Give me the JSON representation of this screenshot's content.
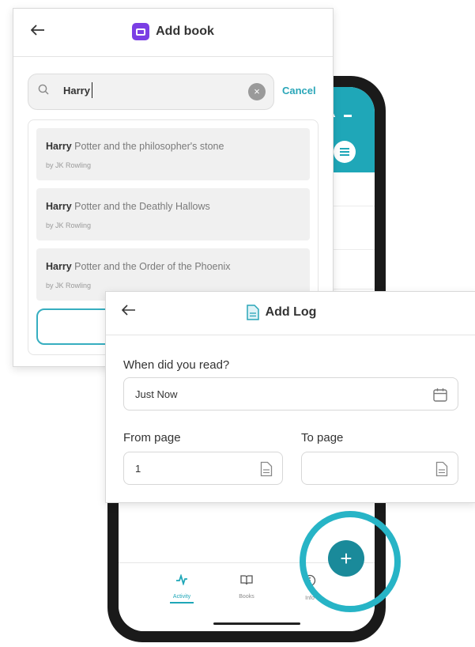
{
  "add_book": {
    "title": "Add book",
    "search": {
      "value": "Harry"
    },
    "cancel_label": "Cancel",
    "results": [
      {
        "match": "Harry",
        "rest": " Potter and the philosopher's stone",
        "author": "by JK Rowling"
      },
      {
        "match": "Harry",
        "rest": " Potter and the Deathly Hallows",
        "author": "by JK Rowling"
      },
      {
        "match": "Harry",
        "rest": " Potter and the Order of the Phoenix",
        "author": "by JK Rowling"
      }
    ]
  },
  "add_log": {
    "title": "Add Log",
    "when_label": "When did you read?",
    "when_value": "Just Now",
    "from_label": "From page",
    "from_value": "1",
    "to_label": "To page",
    "to_value": ""
  },
  "bottom_nav": {
    "items": [
      {
        "label": "Activity",
        "icon": "activity-icon",
        "active": true
      },
      {
        "label": "Books",
        "icon": "book-open-icon",
        "active": false
      },
      {
        "label": "Info",
        "icon": "info-icon",
        "active": false
      }
    ]
  },
  "fab_symbol": "+",
  "colors": {
    "accent": "#1fa7b8",
    "book_badge": "#7b3fe4",
    "fab": "#1a8a9a",
    "ring": "#27b4c6"
  }
}
